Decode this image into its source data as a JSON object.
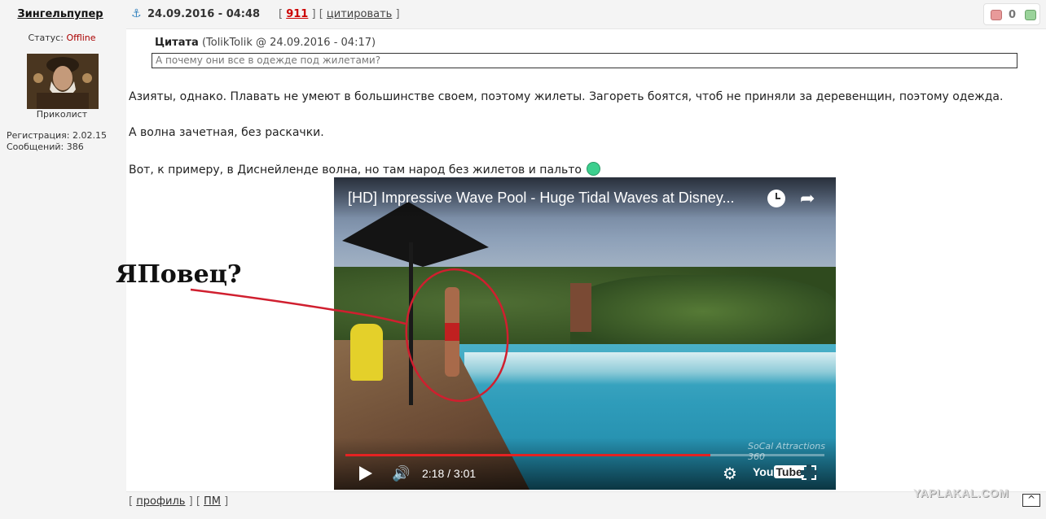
{
  "user": {
    "name": "Зингельпупер",
    "status_label": "Статус:",
    "status_value": "Offline",
    "rank": "Приколист",
    "registration": "Регистрация: 2.02.15",
    "messages": "Сообщений: 386"
  },
  "post": {
    "date": "24.09.2016 - 04:48",
    "bracket_open": "[",
    "bracket_mid": "] [",
    "bracket_close": "]",
    "number": "911",
    "quote_label": "цитировать",
    "rating": "0"
  },
  "quote": {
    "label": "Цитата",
    "source": "(TolikTolik @ 24.09.2016 - 04:17)",
    "text": "А почему они все в одежде под жилетами?"
  },
  "body": {
    "p1": "Азияты, однако. Плавать не умеют в большинстве своем, поэтому жилеты. Загореть боятся, чтоб не приняли за деревенщин, поэтому одежда.",
    "p2": "А волна зачетная, без раскачки.",
    "p3": "Вот, к примеру, в Диснейленде волна, но там народ без жилетов и пальто"
  },
  "video": {
    "title": "[HD] Impressive Wave Pool - Huge Tidal Waves at Disney...",
    "time": "2:18 / 3:01",
    "progress": 0.762,
    "watermark": "SoCal Attractions 360",
    "logo_you": "You",
    "logo_tube": "Tube",
    "accent": "#e52222"
  },
  "annotation": {
    "text": "ЯПовец?",
    "color": "#d01f2f"
  },
  "footer": {
    "open": "[",
    "mid": "] [",
    "close": "]",
    "profile_label": "профиль",
    "pm_label": "ПМ",
    "site": "YAPLAKAL.COM",
    "to_top": "^"
  }
}
